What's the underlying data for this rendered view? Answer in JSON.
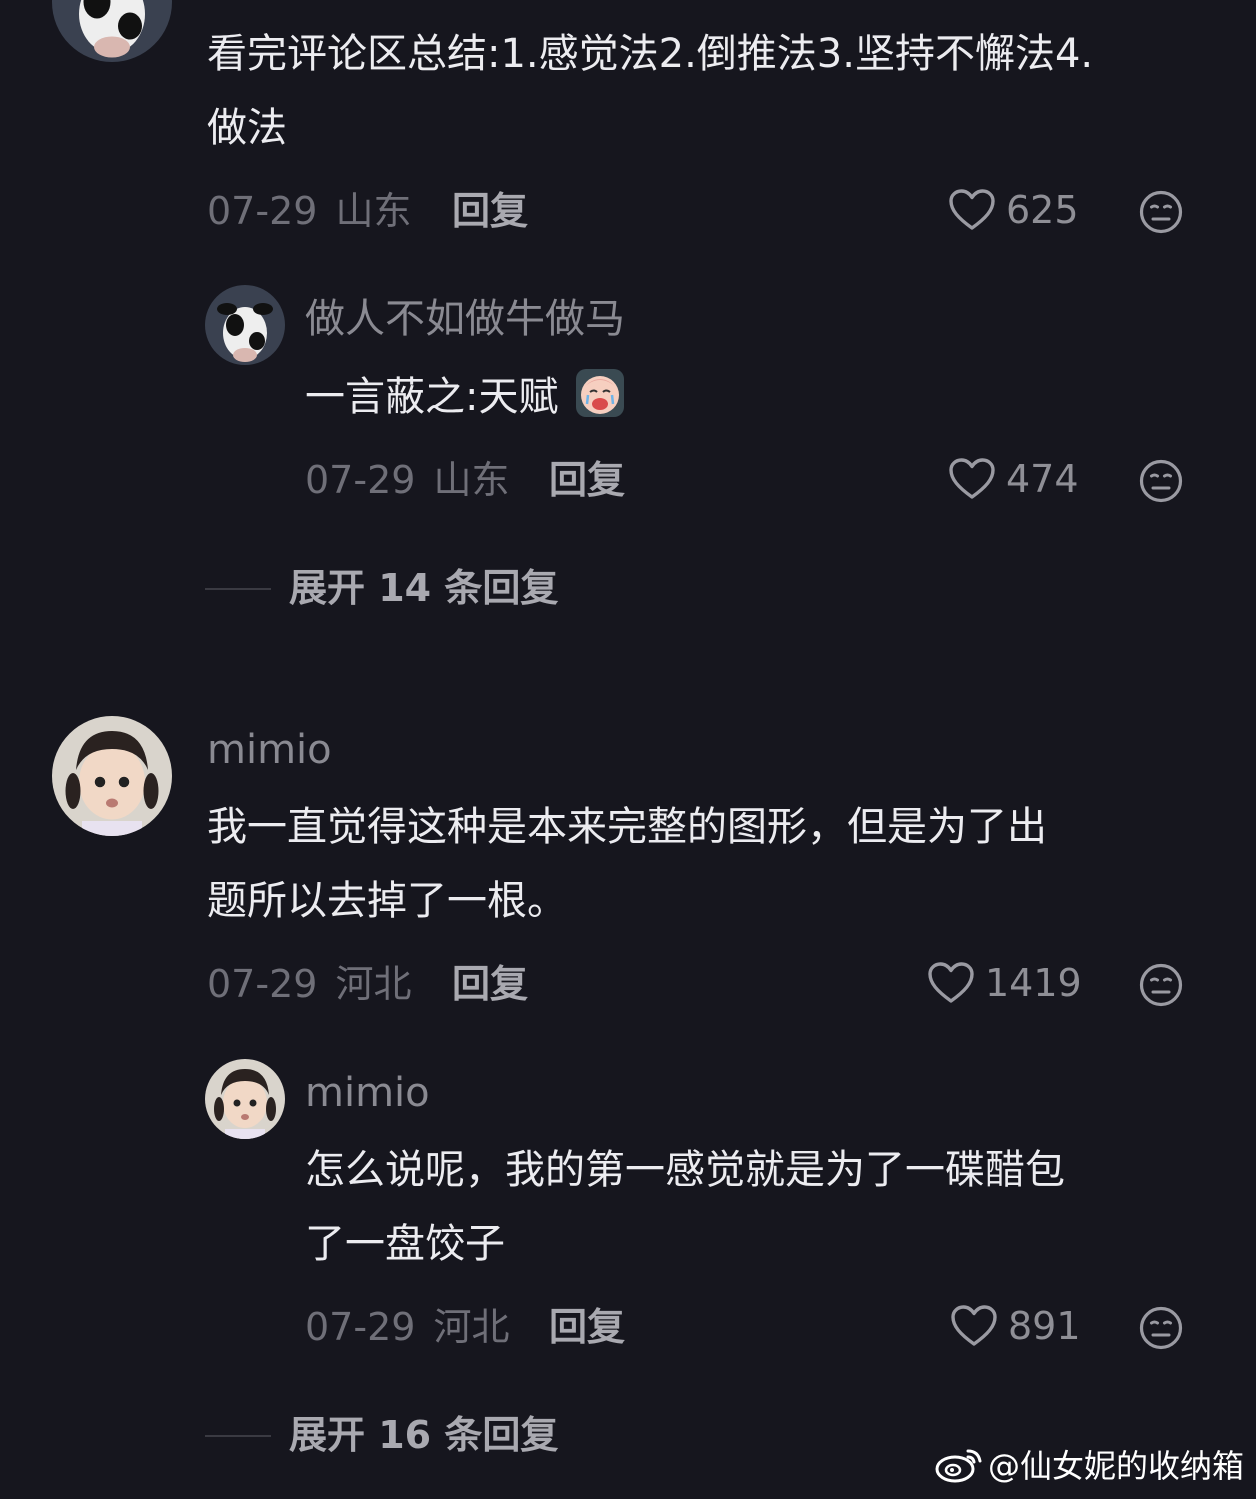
{
  "comments": [
    {
      "content_lines": [
        "看完评论区总结:1.感觉法2.倒推法3.坚持不懈法4.",
        "做法"
      ],
      "date": "07-29",
      "location": "山东",
      "reply_label": "回复",
      "likes": "625",
      "avatar_icon": "cow-avatar",
      "reply": {
        "username": "做人不如做牛做马",
        "content": "一言蔽之:天赋",
        "emoji_icon": "crying-face-emoji",
        "date": "07-29",
        "location": "山东",
        "reply_label": "回复",
        "likes": "474",
        "avatar_icon": "cow-avatar"
      },
      "expand_label": "展开 14 条回复"
    },
    {
      "username": "mimio",
      "content_lines": [
        "我一直觉得这种是本来完整的图形，但是为了出",
        "题所以去掉了一根。"
      ],
      "date": "07-29",
      "location": "河北",
      "reply_label": "回复",
      "likes": "1419",
      "avatar_icon": "girl-avatar",
      "reply": {
        "username": "mimio",
        "content_lines": [
          "怎么说呢，我的第一感觉就是为了一碟醋包",
          "了一盘饺子"
        ],
        "date": "07-29",
        "location": "河北",
        "reply_label": "回复",
        "likes": "891",
        "avatar_icon": "girl-avatar"
      },
      "expand_label": "展开 16 条回复"
    }
  ],
  "watermark": "@仙女妮的收纳箱",
  "icons": {
    "like": "heart-outline-icon",
    "dislike": "neutral-face-icon",
    "weibo": "weibo-logo-icon"
  },
  "colors": {
    "background": "#16161e",
    "text_primary": "#ececf0",
    "text_secondary": "#8a8a92"
  }
}
